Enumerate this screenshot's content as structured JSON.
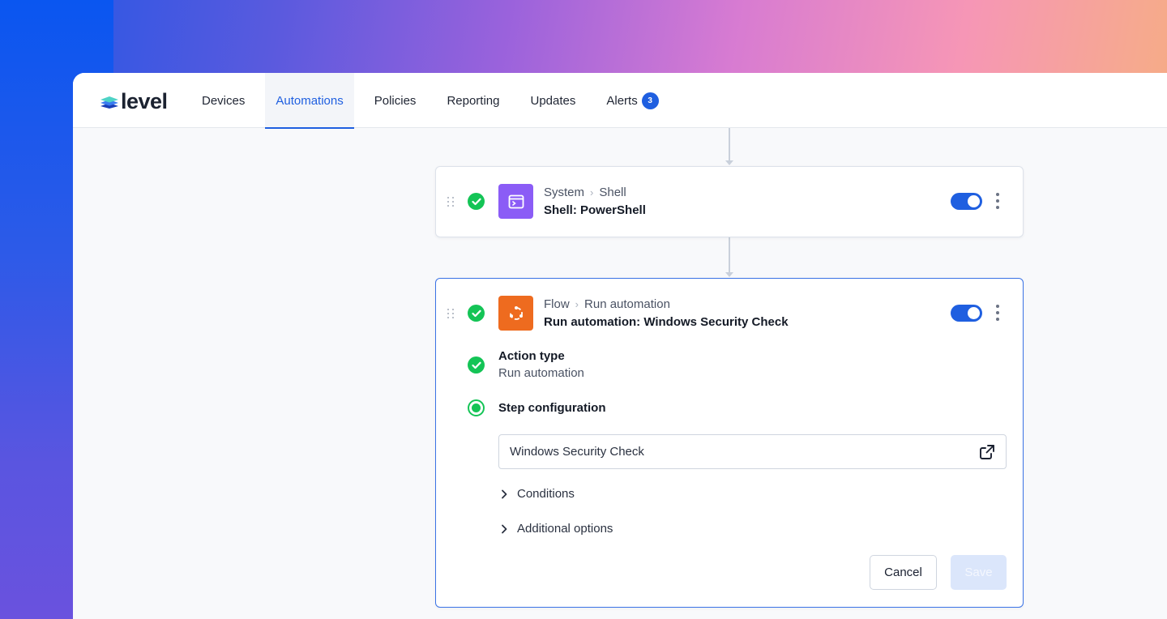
{
  "brand": {
    "logo_text": "level",
    "accent": "#1f5fe0"
  },
  "nav": {
    "items": [
      {
        "label": "Devices"
      },
      {
        "label": "Automations",
        "active": true
      },
      {
        "label": "Policies"
      },
      {
        "label": "Reporting"
      },
      {
        "label": "Updates"
      },
      {
        "label": "Alerts",
        "badge": "3"
      }
    ]
  },
  "steps": [
    {
      "category": "System",
      "action": "Shell",
      "title": "Shell: PowerShell",
      "icon": "terminal-icon",
      "icon_color": "#8b5cf6",
      "enabled": true
    },
    {
      "category": "Flow",
      "action": "Run automation",
      "title": "Run automation: Windows Security Check",
      "icon": "flow-icon",
      "icon_color": "#ee6b1f",
      "enabled": true,
      "expanded": {
        "action_type_title": "Action type",
        "action_type_value": "Run automation",
        "config_title": "Step configuration",
        "automation_field_value": "Windows Security Check",
        "conditions_label": "Conditions",
        "additional_options_label": "Additional options",
        "cancel_label": "Cancel",
        "save_label": "Save"
      }
    }
  ],
  "colors": {
    "success": "#14c456",
    "selected_border": "#3b73e6"
  }
}
